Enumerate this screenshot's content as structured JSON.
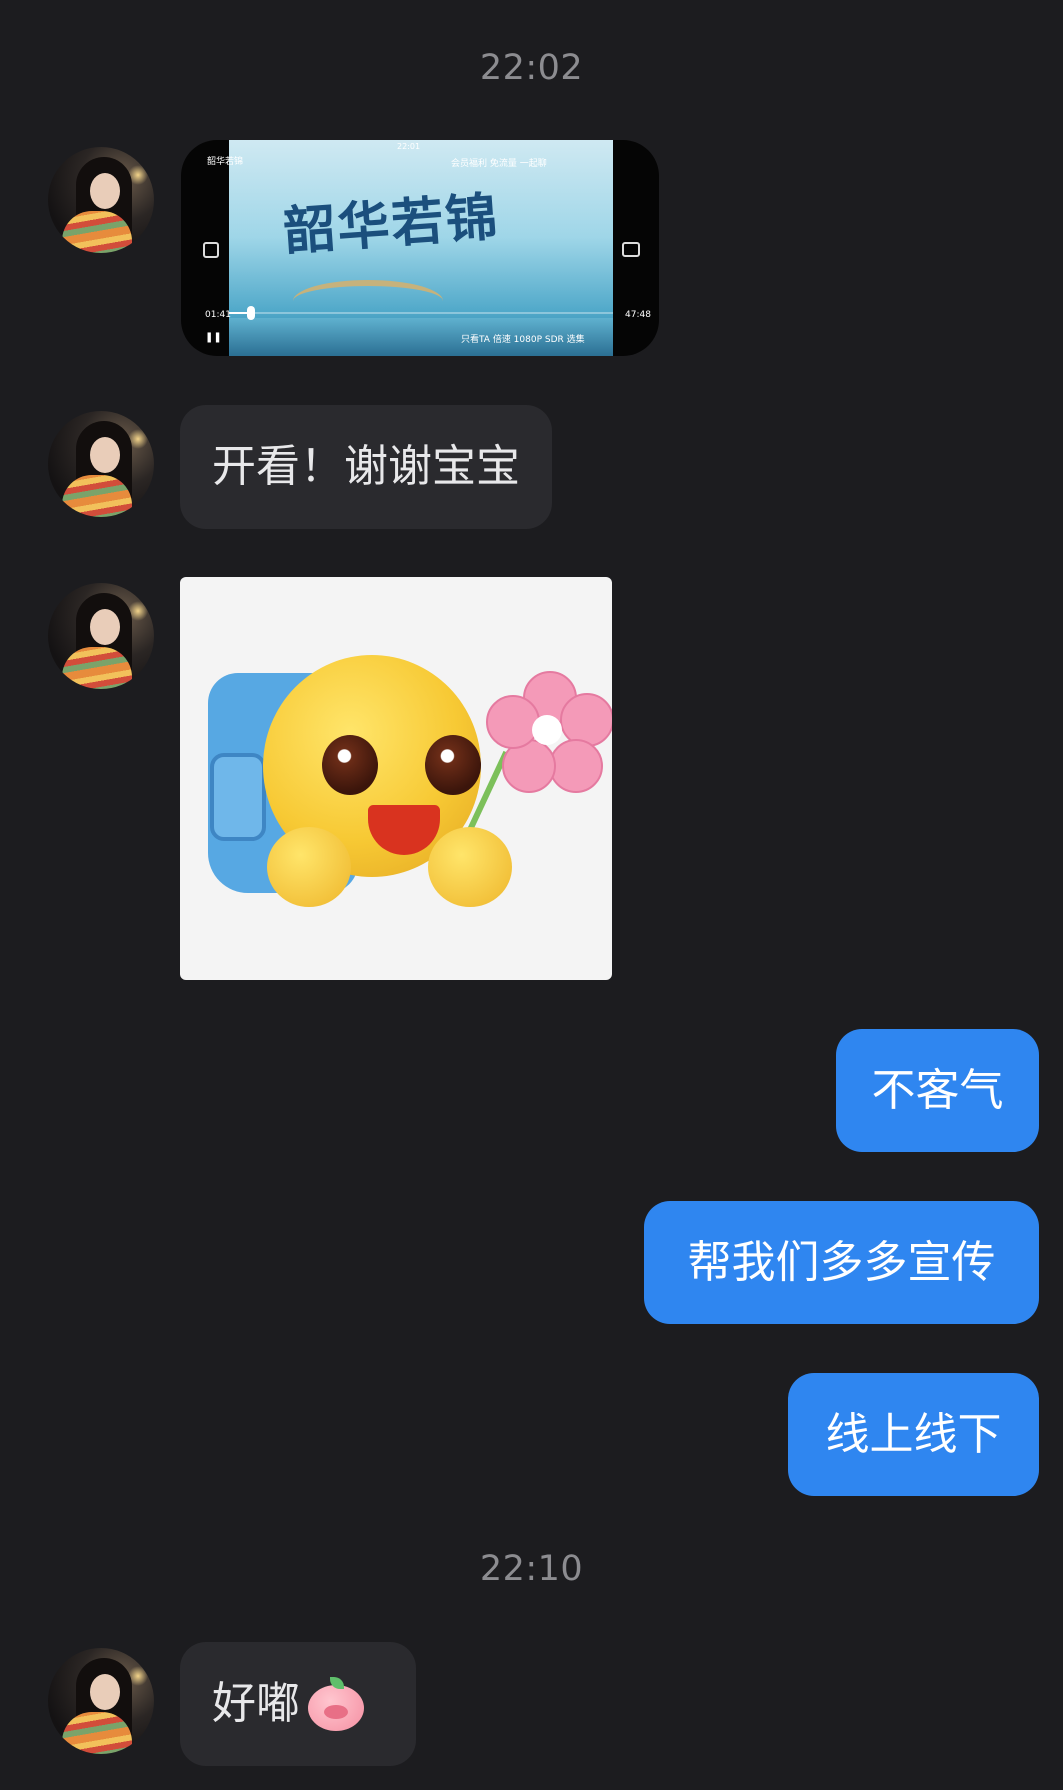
{
  "timestamps": [
    "22:02",
    "22:10"
  ],
  "video": {
    "title": "韶华若锦",
    "top_right": "会员福利   免流量   一起聊",
    "clock": "22:01",
    "time_elapsed": "01:41",
    "time_total": "47:48",
    "bottom_controls": "只看TA   倍速   1080P SDR   选集"
  },
  "messages": [
    {
      "side": "in",
      "text": "开看！谢谢宝宝"
    },
    {
      "side": "out",
      "text": "不客气"
    },
    {
      "side": "out",
      "text": "帮我们多多宣传"
    },
    {
      "side": "out",
      "text": "线上线下"
    },
    {
      "side": "in",
      "text": "好嘟"
    }
  ],
  "colors": {
    "background": "#1c1c1f",
    "incoming_bubble": "#2a2a2e",
    "outgoing_bubble": "#2f86f0",
    "timestamp": "#8c8c90"
  },
  "icons": {
    "sticker": "smiley-with-flower-sticker",
    "pig": "pig-face-emoji"
  }
}
